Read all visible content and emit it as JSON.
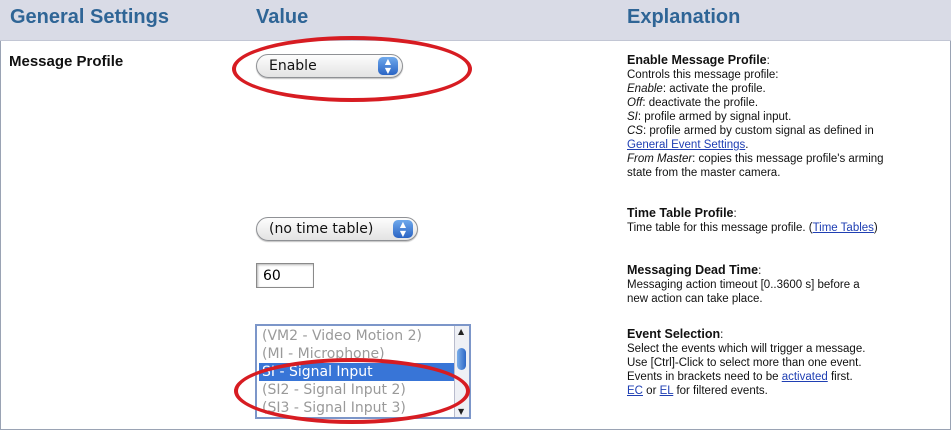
{
  "header": {
    "col1": "General Settings",
    "col2": "Value",
    "col3": "Explanation"
  },
  "row_label": "Message Profile",
  "controls": {
    "profile_select": "Enable",
    "timetable_select": "(no time table)",
    "deadtime_value": "60"
  },
  "event_list": {
    "items": [
      "(VM2 - Video Motion 2)",
      "(MI - Microphone)",
      "SI - Signal Input",
      "(SI2 - Signal Input 2)",
      "(SI3 - Signal Input 3)"
    ],
    "selected_index": 2
  },
  "explanations": {
    "enable": {
      "title": "Enable Message Profile",
      "l1": "Controls this message profile:",
      "l2_term": "Enable",
      "l2_text": ": activate the profile.",
      "l3_term": "Off",
      "l3_text": ": deactivate the profile.",
      "l4_term": "SI",
      "l4_text": ": profile armed by signal input.",
      "l5_term": "CS",
      "l5_text": ": profile armed by custom signal as defined in",
      "l6_link": "General Event Settings",
      "l6_tail": ".",
      "l7_term": "From Master",
      "l7_text": ": copies this message profile's arming",
      "l8": "state from the master camera."
    },
    "timetable": {
      "title": "Time Table Profile",
      "l1": "Time table for this message profile. (",
      "l1_link": "Time Tables",
      "l1_tail": ")"
    },
    "deadtime": {
      "title": "Messaging Dead Time",
      "l1": "Messaging action timeout [0..3600 s] before a",
      "l2": "new action can take place."
    },
    "events": {
      "title": "Event Selection",
      "l1": "Select the events which will trigger a message.",
      "l2": "Use [Ctrl]-Click to select more than one event.",
      "l3": "Events in brackets need to be ",
      "l3_link": "activated",
      "l3_tail": " first.",
      "l4_link1": "EC",
      "l4_mid": " or ",
      "l4_link2": "EL",
      "l4_tail": " for filtered events."
    }
  },
  "colors": {
    "header_bg": "#d9dbe6",
    "header_text": "#2f6596",
    "highlight_oval": "#d71c22",
    "selection": "#3875d7",
    "link": "#1f3fb3"
  }
}
